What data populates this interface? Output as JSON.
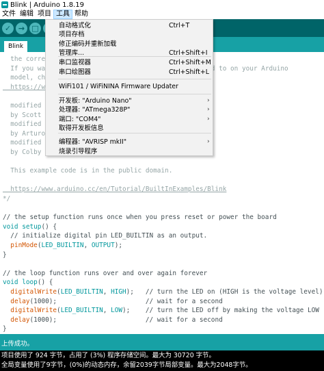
{
  "window": {
    "title": "Blink | Arduino 1.8.19"
  },
  "menubar": {
    "items": [
      "文件",
      "编辑",
      "项目",
      "工具",
      "帮助"
    ]
  },
  "toolbar": {
    "verify": "✓",
    "upload": "→",
    "new": "□",
    "open": "↑",
    "save": "↓"
  },
  "tabs": [
    {
      "label": "Blink"
    }
  ],
  "tools_menu": {
    "items": [
      {
        "label": "自动格式化",
        "shortcut": "Ctrl+T"
      },
      {
        "label": "项目存档",
        "shortcut": ""
      },
      {
        "label": "修正编码并重新加载",
        "shortcut": ""
      },
      {
        "label": "管理库...",
        "shortcut": "Ctrl+Shift+I"
      },
      {
        "label": "串口监视器",
        "shortcut": "Ctrl+Shift+M"
      },
      {
        "label": "串口绘图器",
        "shortcut": "Ctrl+Shift+L"
      },
      {
        "label": "WiFi101 / WiFiNINA Firmware Updater",
        "shortcut": ""
      },
      {
        "label": "开发板: \"Arduino Nano\"",
        "shortcut": ""
      },
      {
        "label": "处理器: \"ATmega328P\"",
        "shortcut": ""
      },
      {
        "label": "端口: \"COM4\"",
        "shortcut": ""
      },
      {
        "label": "取得开发板信息",
        "shortcut": ""
      },
      {
        "label": "编程器: \"AVRISP mkII\"",
        "shortcut": ""
      },
      {
        "label": "烧录引导程序",
        "shortcut": ""
      }
    ],
    "submenu_arrow": "›"
  },
  "editor": {
    "lines": [
      {
        "segs": [
          {
            "t": "  the corre",
            "c": "c-com"
          },
          {
            "t": "                                       ed.",
            "c": "c-com"
          }
        ]
      },
      {
        "segs": [
          {
            "t": "  If you wa",
            "c": "c-com"
          },
          {
            "t": "                                      nected to on your Arduino",
            "c": "c-com"
          }
        ]
      },
      {
        "segs": [
          {
            "t": "  model, ch",
            "c": "c-com"
          }
        ]
      },
      {
        "segs": [
          {
            "t": "  https://w",
            "c": "c-url"
          }
        ]
      },
      {
        "segs": [
          {
            "t": "",
            "c": "c-com"
          }
        ]
      },
      {
        "segs": [
          {
            "t": "  modified ",
            "c": "c-com"
          }
        ]
      },
      {
        "segs": [
          {
            "t": "  by Scott ",
            "c": "c-com"
          }
        ]
      },
      {
        "segs": [
          {
            "t": "  modified ",
            "c": "c-com"
          }
        ]
      },
      {
        "segs": [
          {
            "t": "  by Arturo",
            "c": "c-com"
          }
        ]
      },
      {
        "segs": [
          {
            "t": "  modified ",
            "c": "c-com"
          }
        ]
      },
      {
        "segs": [
          {
            "t": "  by Colby ",
            "c": "c-com"
          }
        ]
      },
      {
        "segs": [
          {
            "t": "",
            "c": "c-com"
          }
        ]
      },
      {
        "segs": [
          {
            "t": "  This example code is in the public domain.",
            "c": "c-com"
          }
        ]
      },
      {
        "segs": [
          {
            "t": "",
            "c": "c-com"
          }
        ]
      },
      {
        "segs": [
          {
            "t": "  https://www.arduino.cc/en/Tutorial/BuiltInExamples/Blink",
            "c": "c-url"
          }
        ]
      },
      {
        "segs": [
          {
            "t": "*/",
            "c": "c-com"
          }
        ]
      },
      {
        "segs": [
          {
            "t": "",
            "c": "c-com"
          }
        ]
      },
      {
        "segs": [
          {
            "t": "// the setup function runs once when you press reset or power the board",
            "c": "c-cm"
          }
        ]
      },
      {
        "segs": [
          {
            "t": "void",
            "c": "c-kw"
          },
          {
            "t": " ",
            "c": "c-plain"
          },
          {
            "t": "setup",
            "c": "c-kw"
          },
          {
            "t": "() {",
            "c": "c-plain"
          }
        ]
      },
      {
        "segs": [
          {
            "t": "  // initialize digital pin LED_BUILTIN as an output.",
            "c": "c-cm"
          }
        ]
      },
      {
        "segs": [
          {
            "t": "  ",
            "c": "c-plain"
          },
          {
            "t": "pinMode",
            "c": "c-fn"
          },
          {
            "t": "(",
            "c": "c-plain"
          },
          {
            "t": "LED_BUILTIN",
            "c": "c-kw"
          },
          {
            "t": ", ",
            "c": "c-plain"
          },
          {
            "t": "OUTPUT",
            "c": "c-kw"
          },
          {
            "t": ");",
            "c": "c-plain"
          }
        ]
      },
      {
        "segs": [
          {
            "t": "}",
            "c": "c-plain"
          }
        ]
      },
      {
        "segs": [
          {
            "t": "",
            "c": "c-plain"
          }
        ]
      },
      {
        "segs": [
          {
            "t": "// the loop function runs over and over again forever",
            "c": "c-cm"
          }
        ]
      },
      {
        "segs": [
          {
            "t": "void",
            "c": "c-kw"
          },
          {
            "t": " ",
            "c": "c-plain"
          },
          {
            "t": "loop",
            "c": "c-kw"
          },
          {
            "t": "() {",
            "c": "c-plain"
          }
        ]
      },
      {
        "segs": [
          {
            "t": "  ",
            "c": "c-plain"
          },
          {
            "t": "digitalWrite",
            "c": "c-fn"
          },
          {
            "t": "(",
            "c": "c-plain"
          },
          {
            "t": "LED_BUILTIN",
            "c": "c-kw"
          },
          {
            "t": ", ",
            "c": "c-plain"
          },
          {
            "t": "HIGH",
            "c": "c-kw"
          },
          {
            "t": ");   // turn the LED on (HIGH is the voltage level)",
            "c": "c-plain"
          }
        ]
      },
      {
        "segs": [
          {
            "t": "  ",
            "c": "c-plain"
          },
          {
            "t": "delay",
            "c": "c-fn"
          },
          {
            "t": "(1000);                       // wait for a second",
            "c": "c-plain"
          }
        ]
      },
      {
        "segs": [
          {
            "t": "  ",
            "c": "c-plain"
          },
          {
            "t": "digitalWrite",
            "c": "c-fn"
          },
          {
            "t": "(",
            "c": "c-plain"
          },
          {
            "t": "LED_BUILTIN",
            "c": "c-kw"
          },
          {
            "t": ", ",
            "c": "c-plain"
          },
          {
            "t": "LOW",
            "c": "c-kw"
          },
          {
            "t": ");    // turn the LED off by making the voltage LOW",
            "c": "c-plain"
          }
        ]
      },
      {
        "segs": [
          {
            "t": "  ",
            "c": "c-plain"
          },
          {
            "t": "delay",
            "c": "c-fn"
          },
          {
            "t": "(1000);                       // wait for a second",
            "c": "c-plain"
          }
        ]
      },
      {
        "segs": [
          {
            "t": "}",
            "c": "c-plain"
          }
        ]
      }
    ]
  },
  "status": {
    "text": "上传成功。"
  },
  "console": {
    "lines": [
      "项目使用了 924 字节，占用了 (3%) 程序存储空间。最大为 30720 字节。",
      "全局变量使用了9字节，(0%)的动态内存，余留2039字节局部变量。最大为2048字节。"
    ]
  },
  "colors": {
    "toolbar": "#006468",
    "tabbar": "#17a1a5",
    "keyword": "#00979c",
    "function": "#d35400",
    "comment": "#95a5a6"
  }
}
